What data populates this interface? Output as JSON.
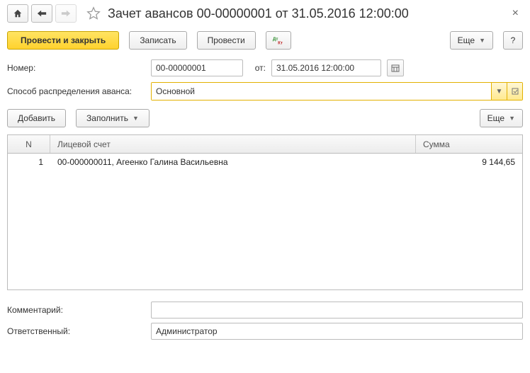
{
  "header": {
    "title": "Зачет авансов 00-00000001 от 31.05.2016 12:00:00"
  },
  "cmdbar": {
    "post_close": "Провести и закрыть",
    "write": "Записать",
    "post": "Провести",
    "more": "Еще",
    "help": "?"
  },
  "fields": {
    "number_label": "Номер:",
    "number_value": "00-00000001",
    "from_label": "от:",
    "date_value": "31.05.2016 12:00:00",
    "dist_label": "Способ распределения аванса:",
    "dist_value": "Основной"
  },
  "subbar": {
    "add": "Добавить",
    "fill": "Заполнить",
    "more": "Еще"
  },
  "table": {
    "columns": {
      "n": "N",
      "account": "Лицевой счет",
      "sum": "Сумма"
    },
    "rows": [
      {
        "n": "1",
        "account": "00-000000011, Агеенко Галина Васильевна",
        "sum": "9 144,65"
      }
    ]
  },
  "footer": {
    "comment_label": "Комментарий:",
    "comment_value": "",
    "resp_label": "Ответственный:",
    "resp_value": "Администратор"
  }
}
